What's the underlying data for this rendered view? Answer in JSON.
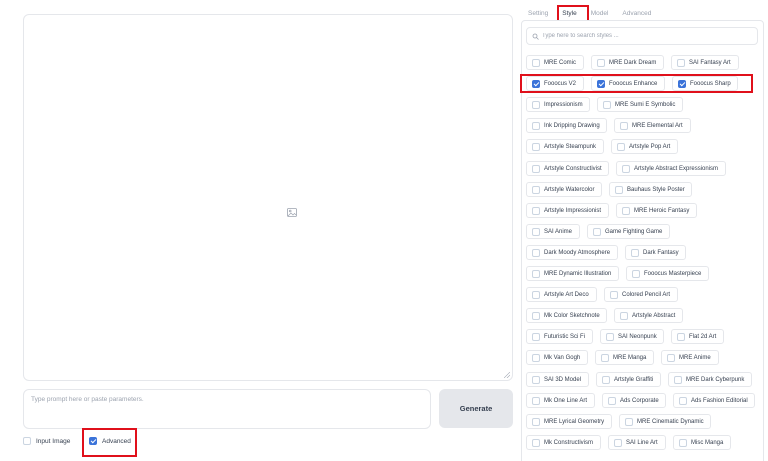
{
  "left": {
    "prompt_placeholder": "Type prompt here or paste parameters.",
    "generate_label": "Generate",
    "input_image": {
      "label": "Input Image",
      "checked": false
    },
    "advanced": {
      "label": "Advanced",
      "checked": true
    }
  },
  "tabs": [
    {
      "label": "Setting",
      "active": false
    },
    {
      "label": "Style",
      "active": true
    },
    {
      "label": "Model",
      "active": false
    },
    {
      "label": "Advanced",
      "active": false
    }
  ],
  "search": {
    "placeholder": "Type here to search styles ..."
  },
  "styles": [
    [
      {
        "label": "MRE Comic",
        "checked": false
      },
      {
        "label": "MRE Dark Dream",
        "checked": false
      },
      {
        "label": "SAI Fantasy Art",
        "checked": false
      }
    ],
    [
      {
        "label": "Fooocus V2",
        "checked": true
      },
      {
        "label": "Fooocus Enhance",
        "checked": true
      },
      {
        "label": "Fooocus Sharp",
        "checked": true
      }
    ],
    [
      {
        "label": "Impressionism",
        "checked": false
      },
      {
        "label": "MRE Sumi E Symbolic",
        "checked": false
      }
    ],
    [
      {
        "label": "Ink Dripping Drawing",
        "checked": false
      },
      {
        "label": "MRE Elemental Art",
        "checked": false
      }
    ],
    [
      {
        "label": "Artstyle Steampunk",
        "checked": false
      },
      {
        "label": "Artstyle Pop Art",
        "checked": false
      }
    ],
    [
      {
        "label": "Artstyle Constructivist",
        "checked": false
      },
      {
        "label": "Artstyle Abstract Expressionism",
        "checked": false
      }
    ],
    [
      {
        "label": "Artstyle Watercolor",
        "checked": false
      },
      {
        "label": "Bauhaus Style Poster",
        "checked": false
      }
    ],
    [
      {
        "label": "Artstyle Impressionist",
        "checked": false
      },
      {
        "label": "MRE Heroic Fantasy",
        "checked": false
      }
    ],
    [
      {
        "label": "SAI Anime",
        "checked": false
      },
      {
        "label": "Game Fighting Game",
        "checked": false
      }
    ],
    [
      {
        "label": "Dark Moody Atmosphere",
        "checked": false
      },
      {
        "label": "Dark Fantasy",
        "checked": false
      }
    ],
    [
      {
        "label": "MRE Dynamic Illustration",
        "checked": false
      },
      {
        "label": "Fooocus Masterpiece",
        "checked": false
      }
    ],
    [
      {
        "label": "Artstyle Art Deco",
        "checked": false
      },
      {
        "label": "Colored Pencil Art",
        "checked": false
      }
    ],
    [
      {
        "label": "Mk Color Sketchnote",
        "checked": false
      },
      {
        "label": "Artstyle Abstract",
        "checked": false
      }
    ],
    [
      {
        "label": "Futuristic Sci Fi",
        "checked": false
      },
      {
        "label": "SAI Neonpunk",
        "checked": false
      },
      {
        "label": "Flat 2d Art",
        "checked": false
      }
    ],
    [
      {
        "label": "Mk Van Gogh",
        "checked": false
      },
      {
        "label": "MRE Manga",
        "checked": false
      },
      {
        "label": "MRE Anime",
        "checked": false
      }
    ],
    [
      {
        "label": "SAI 3D Model",
        "checked": false
      },
      {
        "label": "Artstyle Graffiti",
        "checked": false
      },
      {
        "label": "MRE Dark Cyberpunk",
        "checked": false
      }
    ],
    [
      {
        "label": "Mk One Line Art",
        "checked": false
      },
      {
        "label": "Ads Corporate",
        "checked": false
      },
      {
        "label": "Ads Fashion Editorial",
        "checked": false
      }
    ],
    [
      {
        "label": "MRE Lyrical Geometry",
        "checked": false
      },
      {
        "label": "MRE Cinematic Dynamic",
        "checked": false
      }
    ],
    [
      {
        "label": "Mk Constructivism",
        "checked": false
      },
      {
        "label": "SAI Line Art",
        "checked": false
      },
      {
        "label": "Misc Manga",
        "checked": false
      }
    ]
  ],
  "colors": {
    "accent": "#3b73d9",
    "highlight": "#e0101b",
    "border": "#e5e7eb"
  }
}
